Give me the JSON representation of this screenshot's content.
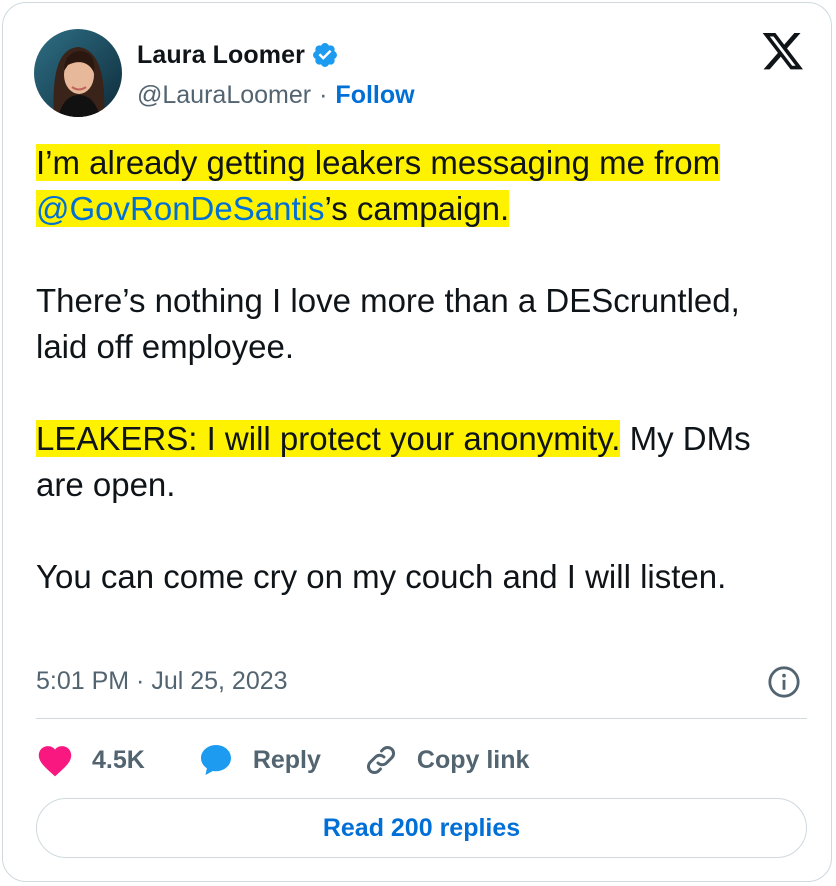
{
  "author": {
    "name": "Laura Loomer",
    "handle": "@LauraLoomer",
    "separator": "·",
    "follow_label": "Follow",
    "verified_icon": "verified-badge-icon",
    "verified_color": "#1d9bf0"
  },
  "platform_logo": "x-logo-icon",
  "tweet": {
    "p1_a": "I’m already getting leakers messaging me from ",
    "p1_mention": "@GovRonDeSantis",
    "p1_b": "’s campaign.",
    "p2": "There’s nothing I love more than a DEScruntled, laid off employee.",
    "p3_hl": "LEAKERS: I will protect your anonymity.",
    "p3_rest": " My DMs are open.",
    "p4": "You can come cry on my couch and I will listen."
  },
  "timestamp": "5:01 PM · Jul 25, 2023",
  "actions": {
    "likes": "4.5K",
    "reply_label": "Reply",
    "copy_link_label": "Copy link"
  },
  "read_replies_label": "Read 200 replies",
  "colors": {
    "highlight": "#fff200",
    "link": "#006fd6",
    "like": "#f91880",
    "reply": "#1d9bf0",
    "muted": "#536471"
  }
}
